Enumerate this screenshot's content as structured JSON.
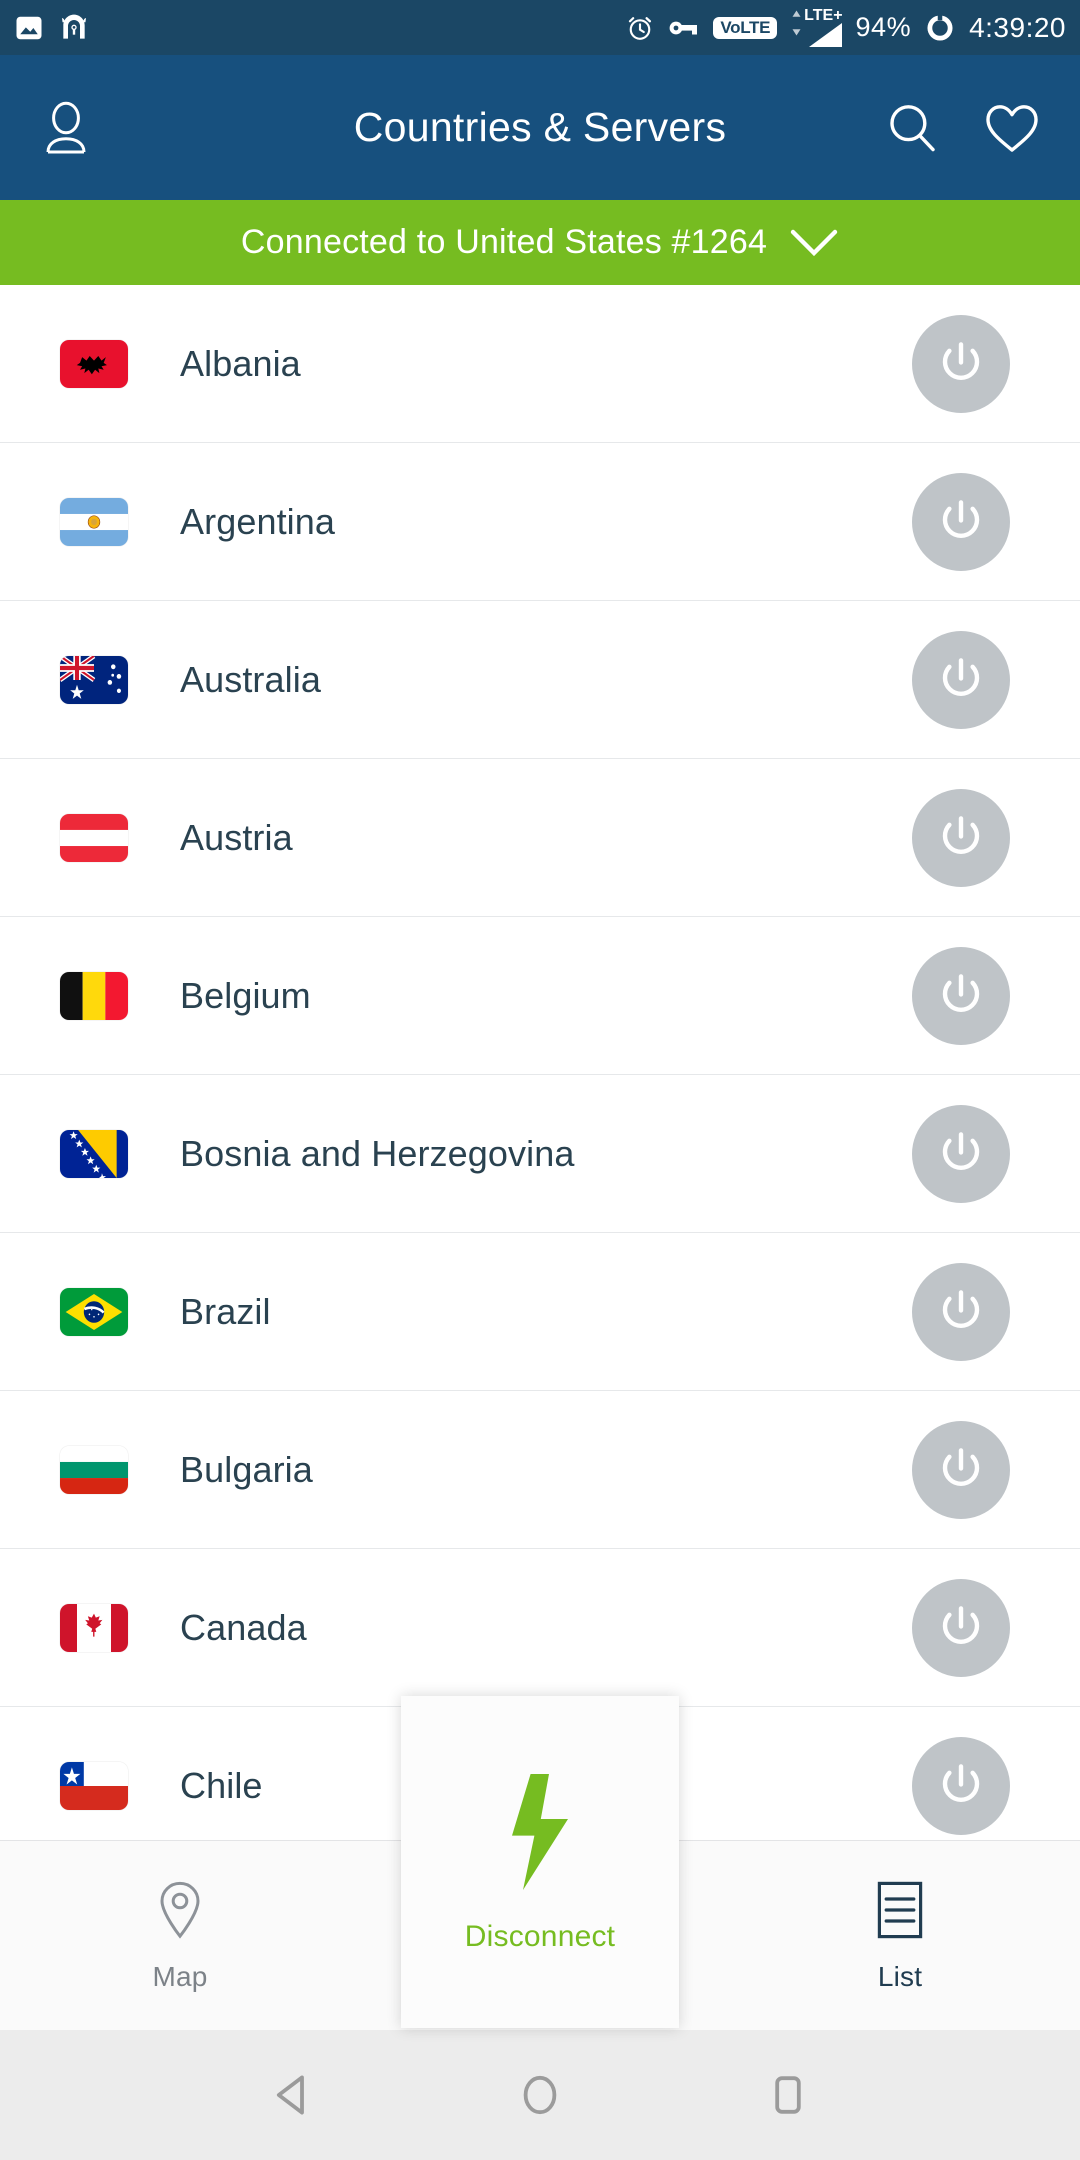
{
  "statusbar": {
    "left_icons": [
      "image-icon",
      "vpn-key-icon"
    ],
    "right_icons": [
      "alarm-icon",
      "key-icon",
      "volte-icon",
      "lte-signal-icon",
      "battery-icon"
    ],
    "volte_label": "VoLTE",
    "lte_label": "LTE+",
    "battery_percent": "94%",
    "time": "4:39:20"
  },
  "appbar": {
    "title": "Countries & Servers",
    "profile_icon": "person-icon",
    "search_icon": "search-icon",
    "favorite_icon": "heart-icon"
  },
  "connection": {
    "status_text": "Connected to United States #1264",
    "expand_icon": "chevron-down-icon",
    "accent_color": "#76bc21"
  },
  "list": {
    "power_icon": "power-icon",
    "countries": [
      {
        "name": "Albania",
        "code": "al"
      },
      {
        "name": "Argentina",
        "code": "ar"
      },
      {
        "name": "Australia",
        "code": "au"
      },
      {
        "name": "Austria",
        "code": "at"
      },
      {
        "name": "Belgium",
        "code": "be"
      },
      {
        "name": "Bosnia and Herzegovina",
        "code": "ba"
      },
      {
        "name": "Brazil",
        "code": "br"
      },
      {
        "name": "Bulgaria",
        "code": "bg"
      },
      {
        "name": "Canada",
        "code": "ca"
      },
      {
        "name": "Chile",
        "code": "cl"
      }
    ]
  },
  "bottomnav": {
    "map_label": "Map",
    "map_icon": "location-pin-icon",
    "disconnect_label": "Disconnect",
    "disconnect_icon": "lightning-bolt-icon",
    "list_label": "List",
    "list_icon": "list-icon"
  },
  "androidnav": {
    "back_icon": "back-triangle-icon",
    "home_icon": "home-circle-icon",
    "recents_icon": "recents-square-icon"
  },
  "colors": {
    "statusbar_bg": "#1b4765",
    "appbar_bg": "#17507e",
    "green": "#76bc21",
    "text_dark": "#2a4250",
    "power_gray": "#bfc4c8"
  }
}
